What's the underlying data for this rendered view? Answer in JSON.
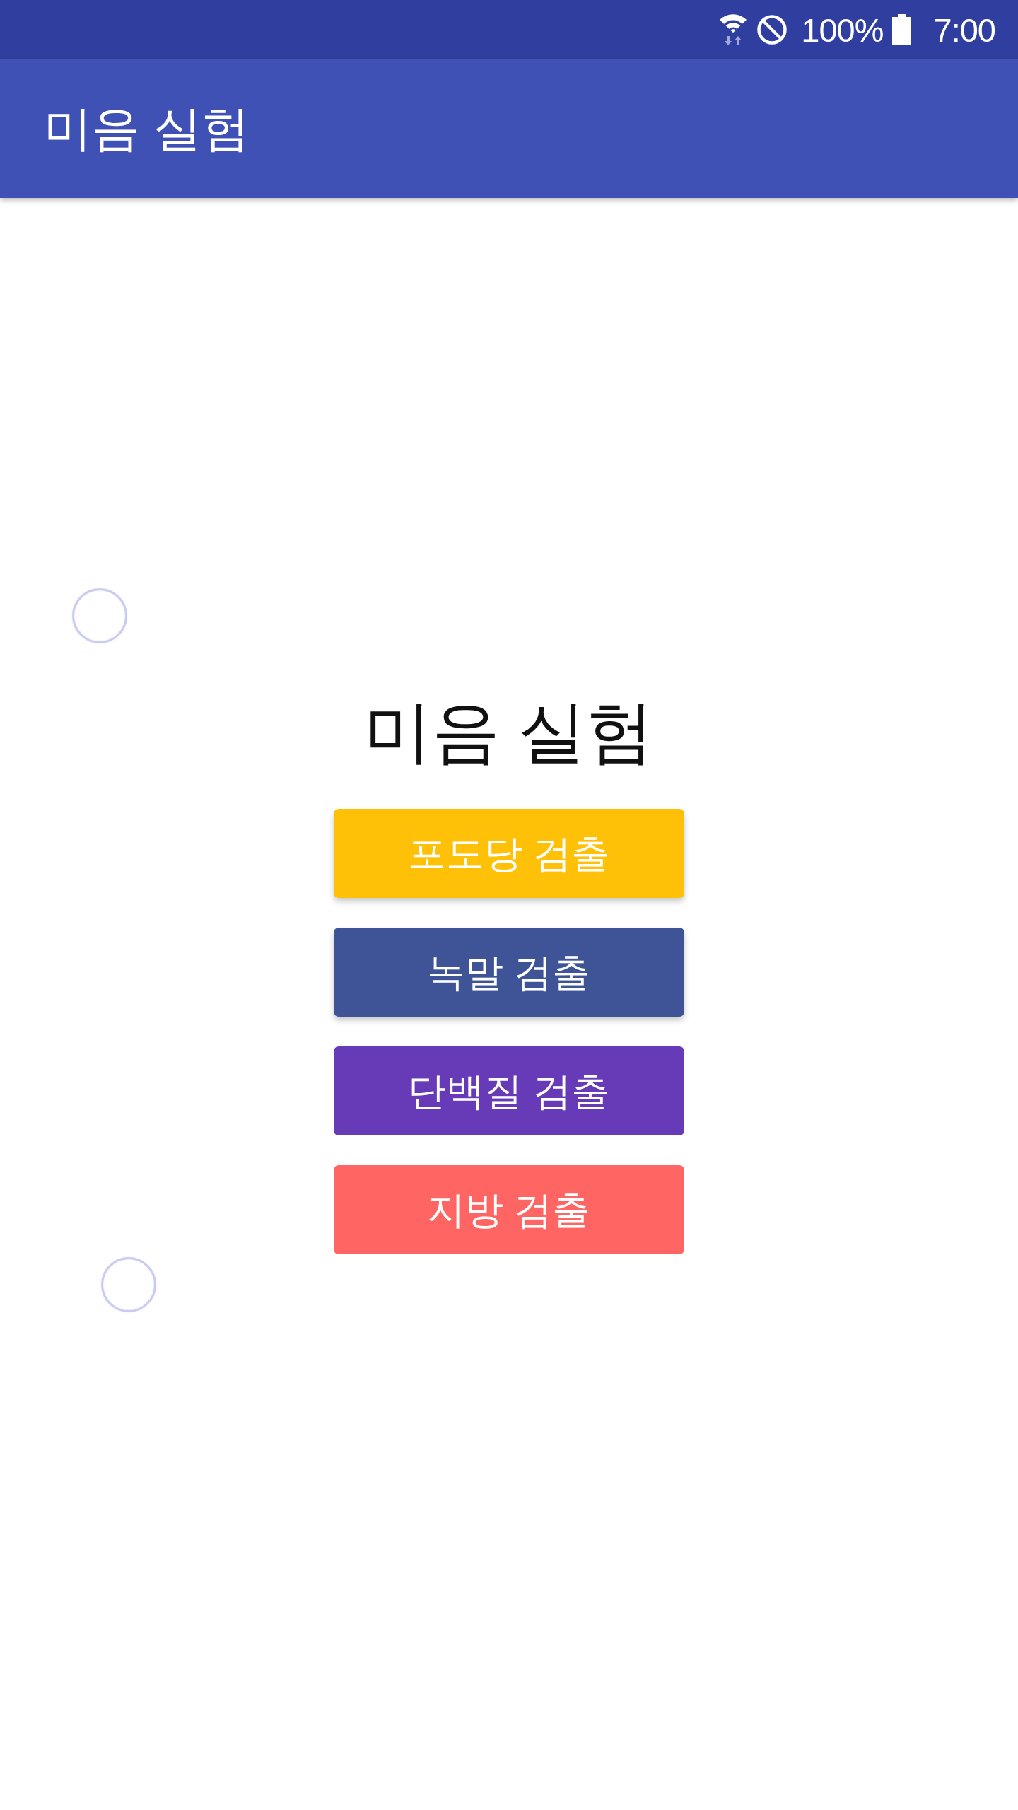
{
  "status_bar": {
    "battery_percent": "100%",
    "time": "7:00"
  },
  "app_bar": {
    "title": "미음 실험"
  },
  "heading": "미음 실험",
  "buttons": [
    {
      "label": "포도당 검출",
      "color": "#ffc107",
      "raised": true
    },
    {
      "label": "녹말 검출",
      "color": "#3f5397",
      "raised": true
    },
    {
      "label": "단백질 검출",
      "color": "#673ab7",
      "raised": false
    },
    {
      "label": "지방 검출",
      "color": "#ff6663",
      "raised": false
    }
  ]
}
